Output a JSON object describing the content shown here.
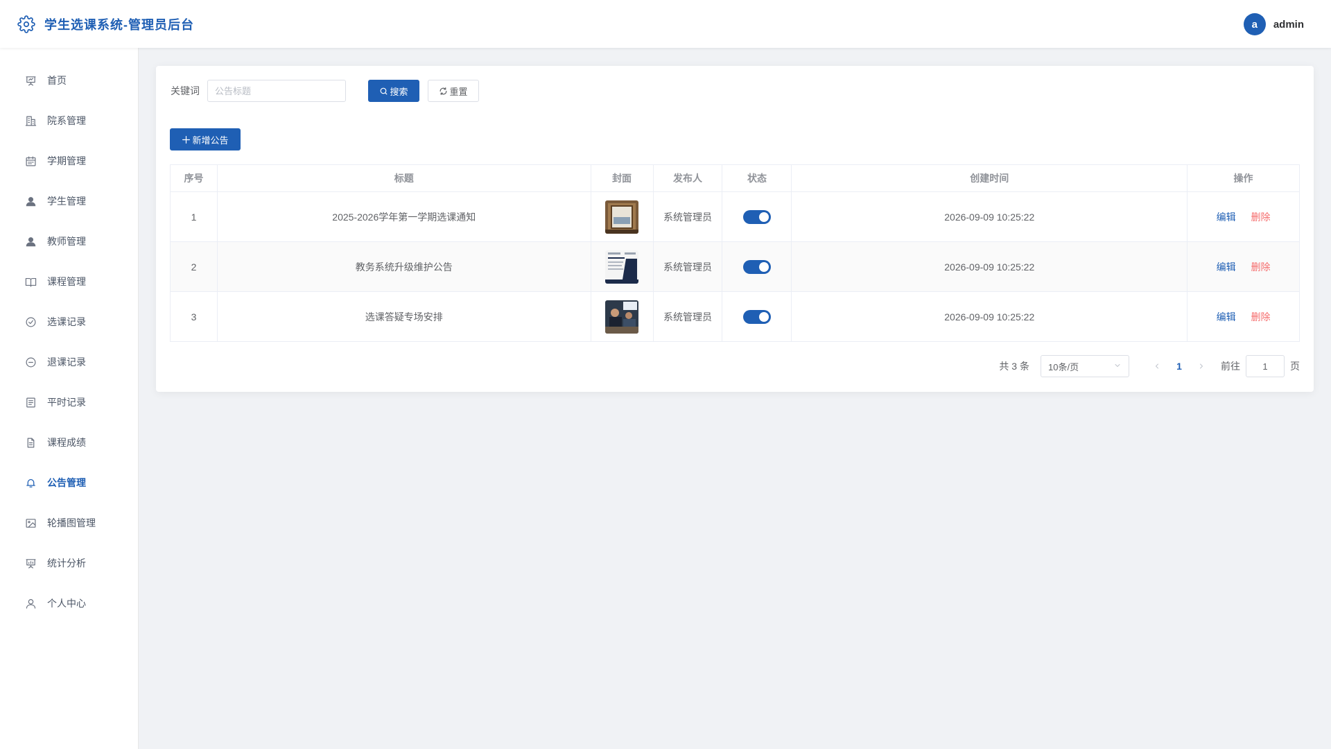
{
  "header": {
    "title": "学生选课系统-管理员后台",
    "user_initial": "a",
    "username": "admin"
  },
  "sidebar": {
    "items": [
      {
        "label": "首页",
        "icon": "presentation-icon"
      },
      {
        "label": "院系管理",
        "icon": "building-icon"
      },
      {
        "label": "学期管理",
        "icon": "calendar-icon"
      },
      {
        "label": "学生管理",
        "icon": "user-filled-icon"
      },
      {
        "label": "教师管理",
        "icon": "user-filled-icon"
      },
      {
        "label": "课程管理",
        "icon": "book-icon"
      },
      {
        "label": "选课记录",
        "icon": "circle-check-icon"
      },
      {
        "label": "退课记录",
        "icon": "circle-minus-icon"
      },
      {
        "label": "平时记录",
        "icon": "tickets-icon"
      },
      {
        "label": "课程成绩",
        "icon": "document-icon"
      },
      {
        "label": "公告管理",
        "icon": "bell-icon",
        "active": true
      },
      {
        "label": "轮播图管理",
        "icon": "picture-icon"
      },
      {
        "label": "统计分析",
        "icon": "data-board-icon"
      },
      {
        "label": "个人中心",
        "icon": "user-icon"
      }
    ]
  },
  "search": {
    "label": "关键词",
    "placeholder": "公告标题",
    "search_label": "搜索",
    "reset_label": "重置"
  },
  "toolbar": {
    "add_label": "新增公告"
  },
  "table": {
    "columns": [
      "序号",
      "标题",
      "封面",
      "发布人",
      "状态",
      "创建时间",
      "操作"
    ],
    "rows": [
      {
        "index": "1",
        "title": "2025-2026学年第一学期选课通知",
        "publisher": "系统管理员",
        "status": true,
        "created": "2026-09-09 10:25:22"
      },
      {
        "index": "2",
        "title": "教务系统升级维护公告",
        "publisher": "系统管理员",
        "status": true,
        "created": "2026-09-09 10:25:22"
      },
      {
        "index": "3",
        "title": "选课答疑专场安排",
        "publisher": "系统管理员",
        "status": true,
        "created": "2026-09-09 10:25:22"
      }
    ],
    "edit_label": "编辑",
    "delete_label": "删除"
  },
  "pagination": {
    "total": "共 3 条",
    "page_size": "10条/页",
    "current_page": "1",
    "goto_label": "前往",
    "goto_value": "1",
    "page_suffix": "页"
  },
  "colors": {
    "primary": "#1f5fb4",
    "danger": "#f56c6c",
    "background": "#f0f2f5"
  }
}
